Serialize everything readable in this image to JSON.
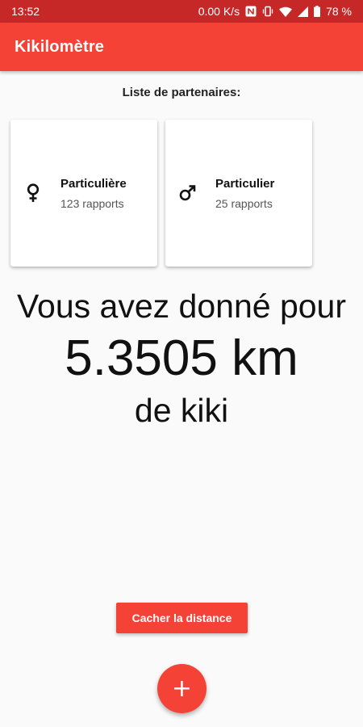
{
  "status_bar": {
    "time": "13:52",
    "net_speed": "0.00 K/s",
    "battery": "78 %",
    "icons": [
      "nfc-icon",
      "vibrate-icon",
      "wifi-icon",
      "signal-icon",
      "battery-icon"
    ]
  },
  "app_bar": {
    "title": "Kikilomètre"
  },
  "partners": {
    "heading": "Liste de partenaires:",
    "items": [
      {
        "icon": "female-symbol-icon",
        "name": "Particulière",
        "reports": "123 rapports"
      },
      {
        "icon": "male-symbol-icon",
        "name": "Particulier",
        "reports": "25 rapports"
      }
    ]
  },
  "summary": {
    "line1": "Vous avez donné pour",
    "distance": "5.3505 km",
    "line3": "de kiki"
  },
  "actions": {
    "hide_distance_label": "Cacher la distance",
    "fab_icon": "plus-icon"
  },
  "colors": {
    "primary": "#f44336",
    "status_bar": "#c62828",
    "background": "#fafafa"
  }
}
